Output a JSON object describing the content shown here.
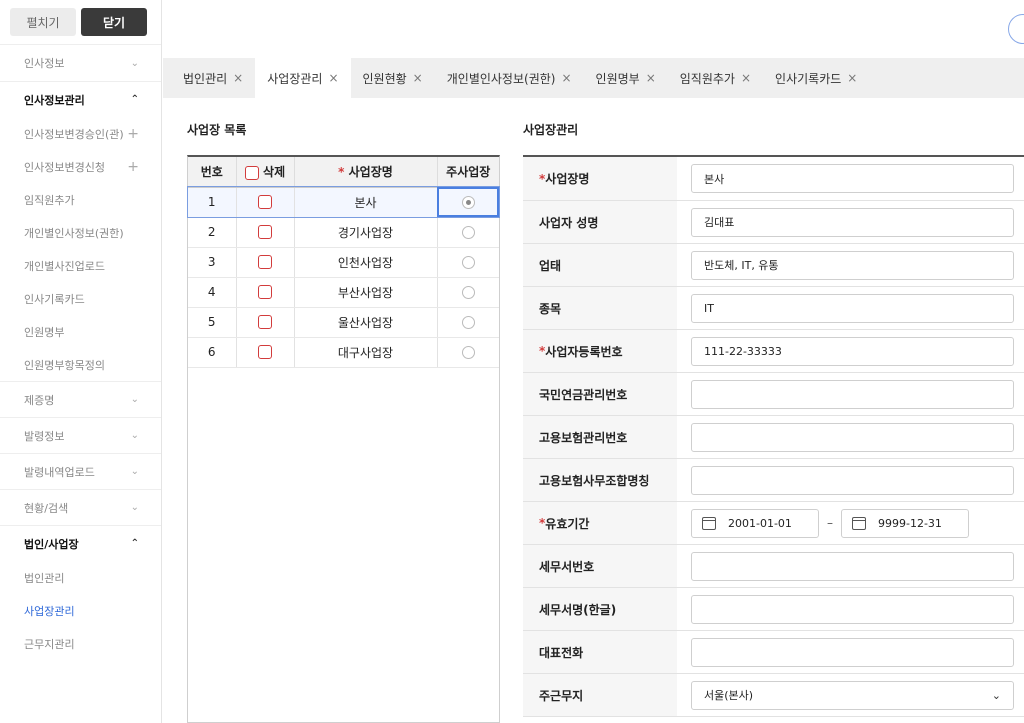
{
  "sidebar": {
    "expand_label": "펼치기",
    "collapse_label": "닫기",
    "menu": [
      {
        "type": "grp",
        "label": "인사정보",
        "icon": "chevron-down-icon",
        "glyph": "⌄"
      },
      {
        "type": "grp",
        "label": "인사정보관리",
        "open": true,
        "icon": "chevron-up-icon",
        "glyph": "⌃"
      },
      {
        "type": "sub",
        "label": "인사정보변경승인(관)",
        "plus": true
      },
      {
        "type": "sub",
        "label": "인사정보변경신청",
        "plus": true
      },
      {
        "type": "sub",
        "label": "임직원추가"
      },
      {
        "type": "sub",
        "label": "개인별인사정보(권한)"
      },
      {
        "type": "sub",
        "label": "개인별사진업로드"
      },
      {
        "type": "sub",
        "label": "인사기록카드"
      },
      {
        "type": "sub",
        "label": "인원명부"
      },
      {
        "type": "sub",
        "label": "인원명부항목정의"
      },
      {
        "type": "grp",
        "label": "제증명",
        "icon": "chevron-down-icon",
        "glyph": "⌄"
      },
      {
        "type": "grp",
        "label": "발령정보",
        "icon": "chevron-down-icon",
        "glyph": "⌄"
      },
      {
        "type": "grp",
        "label": "발령내역업로드",
        "icon": "chevron-down-icon",
        "glyph": "⌄"
      },
      {
        "type": "grp",
        "label": "현황/검색",
        "icon": "chevron-down-icon",
        "glyph": "⌄"
      },
      {
        "type": "grp",
        "label": "법인/사업장",
        "open": true,
        "icon": "chevron-up-icon",
        "glyph": "⌃"
      },
      {
        "type": "sub",
        "label": "법인관리"
      },
      {
        "type": "sub",
        "label": "사업장관리",
        "active": true
      },
      {
        "type": "sub",
        "label": "근무지관리"
      }
    ]
  },
  "tabs": [
    {
      "label": "법인관리"
    },
    {
      "label": "사업장관리",
      "active": true
    },
    {
      "label": "인원현황"
    },
    {
      "label": "개인별인사정보(권한)"
    },
    {
      "label": "인원명부"
    },
    {
      "label": "임직원추가"
    },
    {
      "label": "인사기록카드"
    }
  ],
  "tab_close_glyph": "×",
  "list": {
    "title": "사업장 목록",
    "headers": {
      "no": "번호",
      "delete": "삭제",
      "name_req": "*",
      "name": "사업장명",
      "main": "주사업장"
    },
    "rows": [
      {
        "no": "1",
        "name": "본사",
        "main": true
      },
      {
        "no": "2",
        "name": "경기사업장",
        "main": false
      },
      {
        "no": "3",
        "name": "인천사업장",
        "main": false
      },
      {
        "no": "4",
        "name": "부산사업장",
        "main": false
      },
      {
        "no": "5",
        "name": "울산사업장",
        "main": false
      },
      {
        "no": "6",
        "name": "대구사업장",
        "main": false
      }
    ]
  },
  "form": {
    "title": "사업장관리",
    "rows": [
      {
        "label": "사업장명",
        "required": true,
        "type": "input",
        "value": "본사",
        "h": 44
      },
      {
        "label": "사업자 성명",
        "type": "input",
        "value": "김대표",
        "h": 43
      },
      {
        "label": "업태",
        "type": "input",
        "value": "반도체, IT, 유통",
        "h": 43
      },
      {
        "label": "종목",
        "type": "input",
        "value": "IT",
        "h": 43
      },
      {
        "label": "사업자등록번호",
        "required": true,
        "type": "input",
        "value": "111-22-33333",
        "h": 43
      },
      {
        "label": "국민연금관리번호",
        "type": "input",
        "value": "",
        "h": 43
      },
      {
        "label": "고용보험관리번호",
        "type": "input",
        "value": "",
        "h": 43
      },
      {
        "label": "고용보험사무조합명칭",
        "type": "input",
        "value": "",
        "h": 43
      },
      {
        "label": "유효기간",
        "required": true,
        "type": "daterange",
        "from": "2001-01-01",
        "to": "9999-12-31",
        "h": 43
      },
      {
        "label": "세무서번호",
        "type": "input",
        "value": "",
        "h": 43
      },
      {
        "label": "세무서명(한글)",
        "type": "input",
        "value": "",
        "h": 43
      },
      {
        "label": "대표전화",
        "type": "input",
        "value": "",
        "h": 43
      },
      {
        "label": "주근무지",
        "type": "select",
        "value": "서울(본사)",
        "h": 43
      }
    ],
    "date_separator": "–"
  }
}
